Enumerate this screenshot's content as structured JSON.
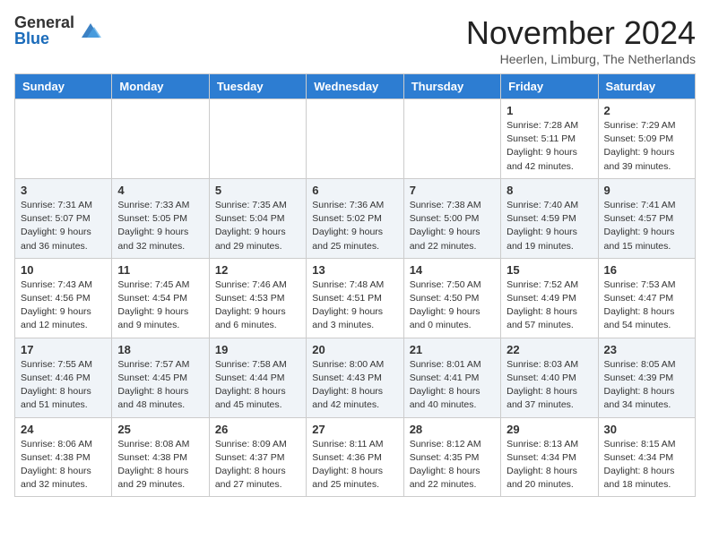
{
  "logo": {
    "general": "General",
    "blue": "Blue"
  },
  "title": "November 2024",
  "subtitle": "Heerlen, Limburg, The Netherlands",
  "days_of_week": [
    "Sunday",
    "Monday",
    "Tuesday",
    "Wednesday",
    "Thursday",
    "Friday",
    "Saturday"
  ],
  "weeks": [
    [
      {
        "day": "",
        "info": ""
      },
      {
        "day": "",
        "info": ""
      },
      {
        "day": "",
        "info": ""
      },
      {
        "day": "",
        "info": ""
      },
      {
        "day": "",
        "info": ""
      },
      {
        "day": "1",
        "info": "Sunrise: 7:28 AM\nSunset: 5:11 PM\nDaylight: 9 hours and 42 minutes."
      },
      {
        "day": "2",
        "info": "Sunrise: 7:29 AM\nSunset: 5:09 PM\nDaylight: 9 hours and 39 minutes."
      }
    ],
    [
      {
        "day": "3",
        "info": "Sunrise: 7:31 AM\nSunset: 5:07 PM\nDaylight: 9 hours and 36 minutes."
      },
      {
        "day": "4",
        "info": "Sunrise: 7:33 AM\nSunset: 5:05 PM\nDaylight: 9 hours and 32 minutes."
      },
      {
        "day": "5",
        "info": "Sunrise: 7:35 AM\nSunset: 5:04 PM\nDaylight: 9 hours and 29 minutes."
      },
      {
        "day": "6",
        "info": "Sunrise: 7:36 AM\nSunset: 5:02 PM\nDaylight: 9 hours and 25 minutes."
      },
      {
        "day": "7",
        "info": "Sunrise: 7:38 AM\nSunset: 5:00 PM\nDaylight: 9 hours and 22 minutes."
      },
      {
        "day": "8",
        "info": "Sunrise: 7:40 AM\nSunset: 4:59 PM\nDaylight: 9 hours and 19 minutes."
      },
      {
        "day": "9",
        "info": "Sunrise: 7:41 AM\nSunset: 4:57 PM\nDaylight: 9 hours and 15 minutes."
      }
    ],
    [
      {
        "day": "10",
        "info": "Sunrise: 7:43 AM\nSunset: 4:56 PM\nDaylight: 9 hours and 12 minutes."
      },
      {
        "day": "11",
        "info": "Sunrise: 7:45 AM\nSunset: 4:54 PM\nDaylight: 9 hours and 9 minutes."
      },
      {
        "day": "12",
        "info": "Sunrise: 7:46 AM\nSunset: 4:53 PM\nDaylight: 9 hours and 6 minutes."
      },
      {
        "day": "13",
        "info": "Sunrise: 7:48 AM\nSunset: 4:51 PM\nDaylight: 9 hours and 3 minutes."
      },
      {
        "day": "14",
        "info": "Sunrise: 7:50 AM\nSunset: 4:50 PM\nDaylight: 9 hours and 0 minutes."
      },
      {
        "day": "15",
        "info": "Sunrise: 7:52 AM\nSunset: 4:49 PM\nDaylight: 8 hours and 57 minutes."
      },
      {
        "day": "16",
        "info": "Sunrise: 7:53 AM\nSunset: 4:47 PM\nDaylight: 8 hours and 54 minutes."
      }
    ],
    [
      {
        "day": "17",
        "info": "Sunrise: 7:55 AM\nSunset: 4:46 PM\nDaylight: 8 hours and 51 minutes."
      },
      {
        "day": "18",
        "info": "Sunrise: 7:57 AM\nSunset: 4:45 PM\nDaylight: 8 hours and 48 minutes."
      },
      {
        "day": "19",
        "info": "Sunrise: 7:58 AM\nSunset: 4:44 PM\nDaylight: 8 hours and 45 minutes."
      },
      {
        "day": "20",
        "info": "Sunrise: 8:00 AM\nSunset: 4:43 PM\nDaylight: 8 hours and 42 minutes."
      },
      {
        "day": "21",
        "info": "Sunrise: 8:01 AM\nSunset: 4:41 PM\nDaylight: 8 hours and 40 minutes."
      },
      {
        "day": "22",
        "info": "Sunrise: 8:03 AM\nSunset: 4:40 PM\nDaylight: 8 hours and 37 minutes."
      },
      {
        "day": "23",
        "info": "Sunrise: 8:05 AM\nSunset: 4:39 PM\nDaylight: 8 hours and 34 minutes."
      }
    ],
    [
      {
        "day": "24",
        "info": "Sunrise: 8:06 AM\nSunset: 4:38 PM\nDaylight: 8 hours and 32 minutes."
      },
      {
        "day": "25",
        "info": "Sunrise: 8:08 AM\nSunset: 4:38 PM\nDaylight: 8 hours and 29 minutes."
      },
      {
        "day": "26",
        "info": "Sunrise: 8:09 AM\nSunset: 4:37 PM\nDaylight: 8 hours and 27 minutes."
      },
      {
        "day": "27",
        "info": "Sunrise: 8:11 AM\nSunset: 4:36 PM\nDaylight: 8 hours and 25 minutes."
      },
      {
        "day": "28",
        "info": "Sunrise: 8:12 AM\nSunset: 4:35 PM\nDaylight: 8 hours and 22 minutes."
      },
      {
        "day": "29",
        "info": "Sunrise: 8:13 AM\nSunset: 4:34 PM\nDaylight: 8 hours and 20 minutes."
      },
      {
        "day": "30",
        "info": "Sunrise: 8:15 AM\nSunset: 4:34 PM\nDaylight: 8 hours and 18 minutes."
      }
    ]
  ]
}
